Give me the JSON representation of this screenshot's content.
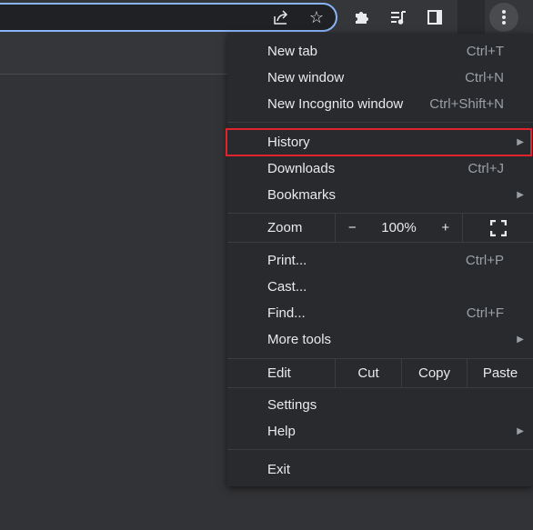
{
  "toolbar": {
    "icons": [
      "share-icon",
      "star-icon",
      "extensions-icon",
      "media-queue-icon",
      "side-panel-icon",
      "more-vert-icon"
    ]
  },
  "menu": {
    "new_tab": {
      "label": "New tab",
      "shortcut": "Ctrl+T"
    },
    "new_window": {
      "label": "New window",
      "shortcut": "Ctrl+N"
    },
    "new_incognito": {
      "label": "New Incognito window",
      "shortcut": "Ctrl+Shift+N"
    },
    "history": {
      "label": "History"
    },
    "downloads": {
      "label": "Downloads",
      "shortcut": "Ctrl+J"
    },
    "bookmarks": {
      "label": "Bookmarks"
    },
    "zoom": {
      "label": "Zoom",
      "minus": "−",
      "value": "100%",
      "plus": "+"
    },
    "print": {
      "label": "Print...",
      "shortcut": "Ctrl+P"
    },
    "cast": {
      "label": "Cast..."
    },
    "find": {
      "label": "Find...",
      "shortcut": "Ctrl+F"
    },
    "more_tools": {
      "label": "More tools"
    },
    "edit": {
      "label": "Edit",
      "cut": "Cut",
      "copy": "Copy",
      "paste": "Paste"
    },
    "settings": {
      "label": "Settings"
    },
    "help": {
      "label": "Help"
    },
    "exit": {
      "label": "Exit"
    }
  },
  "highlight_color": "#e0232c"
}
